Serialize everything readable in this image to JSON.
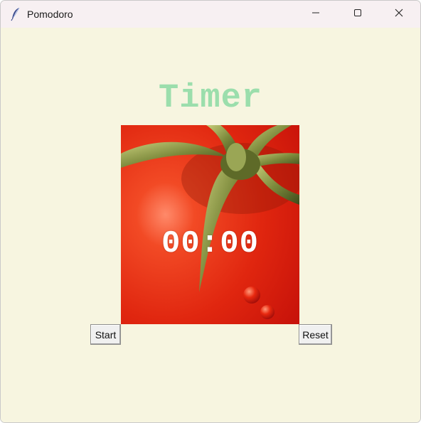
{
  "window": {
    "title": "Pomodoro",
    "icon": "tk-feather-icon",
    "controls": [
      "minimize-icon",
      "maximize-icon",
      "close-icon"
    ]
  },
  "main": {
    "heading": "Timer",
    "time_display": "00:00",
    "start_label": "Start",
    "reset_label": "Reset"
  },
  "colors": {
    "background": "#f7f5e0",
    "heading": "#9bdeac",
    "tomato": "#e0260f",
    "time_text": "#ffffff"
  }
}
